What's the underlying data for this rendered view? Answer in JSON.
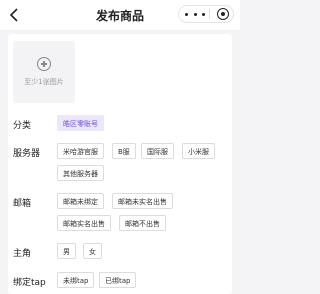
{
  "header": {
    "title": "发布商品"
  },
  "upload": {
    "hint": "至少1张图片"
  },
  "category": {
    "label": "分类",
    "tags": [
      "皓区零账号"
    ]
  },
  "server": {
    "label": "服务器",
    "tags": [
      "米哈游官服",
      "B服",
      "国际服",
      "小米服",
      "其他服务器"
    ]
  },
  "email": {
    "label": "邮箱",
    "tags": [
      "邮箱未绑定",
      "邮箱未实名出售",
      "邮箱实名出售",
      "邮箱不出售"
    ]
  },
  "role": {
    "label": "主角",
    "tags": [
      "男",
      "女"
    ]
  },
  "taptap": {
    "label": "绑定tap",
    "tags": [
      "未绑tap",
      "已绑tap"
    ]
  }
}
